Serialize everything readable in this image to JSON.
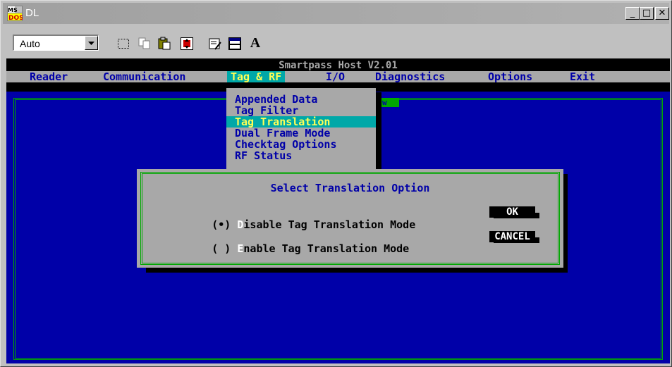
{
  "window": {
    "title": "DL"
  },
  "toolbar": {
    "font_size_value": "Auto",
    "font_button_label": "A",
    "icons": [
      "dropdown-arrow-icon",
      "mark-icon",
      "copy-icon",
      "paste-icon",
      "fullscreen-icon",
      "properties-icon",
      "background-icon",
      "font-icon"
    ]
  },
  "title_buttons": {
    "minimize": "_",
    "maximize": "□",
    "close": "✕"
  },
  "dos": {
    "header": "Smartpass Host V2.01",
    "menu": [
      "Reader",
      "Communication",
      "Tag & RF",
      "I/O",
      "Diagnostics",
      "Options",
      "Exit"
    ],
    "selected_menu": "Tag & RF",
    "dropdown": [
      "Appended Data",
      "Tag Filter",
      "Tag Translation",
      "Dual Frame Mode",
      "Checktag Options",
      "RF Status"
    ],
    "selected_dropdown": "Tag Translation",
    "fragment": "w"
  },
  "dialog": {
    "title": "Select Translation Option",
    "option1": {
      "marker": "(•) ",
      "hotkey": "D",
      "rest": "isable Tag Translation Mode",
      "selected": true
    },
    "option2": {
      "marker": "( ) ",
      "hotkey": "E",
      "rest": "nable Tag Translation Mode",
      "selected": false
    },
    "ok_label": "OK",
    "cancel_label": "CANCEL"
  },
  "colors": {
    "dos_blue": "#0000a8",
    "menu_gray": "#a8a8a8",
    "highlight_cyan": "#00a8a8",
    "highlight_text": "#ffff55",
    "frame_green": "#00a800"
  }
}
